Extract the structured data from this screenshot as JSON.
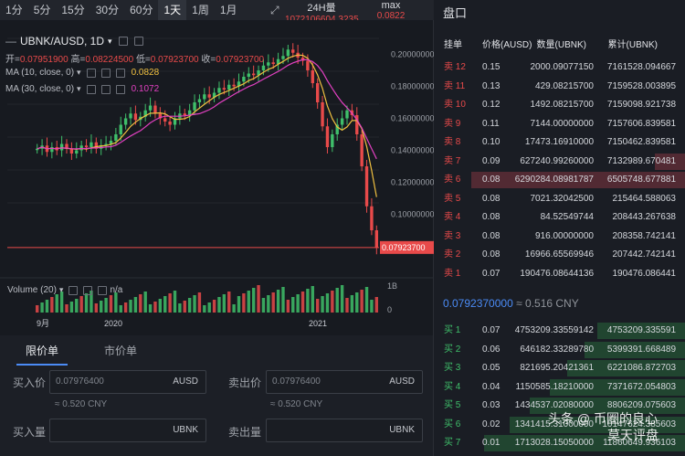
{
  "intervals": [
    "1分",
    "5分",
    "15分",
    "30分",
    "60分",
    "1天",
    "1周",
    "1月"
  ],
  "active_interval": "1天",
  "stats": {
    "volume_label": "24H量",
    "volume_value": "1072106604.3235",
    "max_label": "max",
    "max_value": "0.0822"
  },
  "chart": {
    "pair": "UBNK/AUSD, 1D",
    "ohlc": {
      "open_label": "开=",
      "open": "0.07951900",
      "high_label": "高=",
      "high": "0.08224500",
      "low_label": "低=",
      "low": "0.07923700",
      "close_label": "收=",
      "close": "0.07923700"
    },
    "ma10": {
      "label": "MA (10, close, 0)",
      "value": "0.0828"
    },
    "ma30": {
      "label": "MA (30, close, 0)",
      "value": "0.1072"
    },
    "volume_label": "Volume (20)",
    "volume_value": "n/a",
    "volume_axis": "1B",
    "volume_axis_zero": "0",
    "price_ticks": [
      "0.20000000",
      "0.18000000",
      "0.16000000",
      "0.14000000",
      "0.12000000",
      "0.10000000"
    ],
    "last_price": "0.07923700",
    "x_labels": [
      "9月",
      "2020",
      "2021"
    ],
    "colors": {
      "up": "#3fbf6a",
      "down": "#e84a4a",
      "ma10": "#f0c040",
      "ma30": "#e040c0"
    }
  },
  "chart_data": {
    "type": "candlestick",
    "title": "UBNK/AUSD, 1D",
    "ylim": [
      0.07,
      0.21
    ],
    "x_labels": [
      "9月",
      "2020",
      "2021"
    ],
    "close_series": [
      0.141,
      0.143,
      0.139,
      0.142,
      0.14,
      0.144,
      0.141,
      0.138,
      0.14,
      0.143,
      0.142,
      0.145,
      0.141,
      0.143,
      0.144,
      0.146,
      0.15,
      0.156,
      0.16,
      0.163,
      0.159,
      0.161,
      0.165,
      0.168,
      0.163,
      0.16,
      0.158,
      0.156,
      0.16,
      0.163,
      0.162,
      0.165,
      0.17,
      0.172,
      0.175,
      0.173,
      0.176,
      0.179,
      0.178,
      0.181,
      0.18,
      0.183,
      0.186,
      0.188,
      0.187,
      0.19,
      0.193,
      0.195,
      0.194,
      0.197,
      0.199,
      0.203,
      0.201,
      0.198,
      0.196,
      0.19,
      0.182,
      0.17,
      0.155,
      0.142,
      0.15,
      0.156,
      0.16,
      0.165,
      0.162,
      0.15,
      0.13,
      0.105,
      0.09,
      0.079
    ],
    "ma10": 0.0828,
    "ma30": 0.1072,
    "last": 0.079237
  },
  "form": {
    "tabs": [
      "限价单",
      "市价单"
    ],
    "active_tab": "限价单",
    "buy": {
      "price_label": "买入价",
      "price_value": "0.07976400",
      "price_unit": "AUSD",
      "cny": "≈ 0.520 CNY",
      "amount_label": "买入量",
      "amount_unit": "UBNK"
    },
    "sell": {
      "price_label": "卖出价",
      "price_value": "0.07976400",
      "price_unit": "AUSD",
      "cny": "≈ 0.520 CNY",
      "amount_label": "卖出量",
      "amount_unit": "UBNK"
    }
  },
  "book": {
    "title": "盘口",
    "headers": [
      "挂单",
      "价格(AUSD)",
      "数量(UBNK)",
      "累计(UBNK)"
    ],
    "asks": [
      {
        "label": "卖 12",
        "price": "0.15",
        "qty": "2000.09077150",
        "total": "7161528.094667",
        "depth": 0.0
      },
      {
        "label": "卖 11",
        "price": "0.13",
        "qty": "429.08215700",
        "total": "7159528.003895",
        "depth": 0.0
      },
      {
        "label": "卖 10",
        "price": "0.12",
        "qty": "1492.08215700",
        "total": "7159098.921738",
        "depth": 0.0
      },
      {
        "label": "卖 9",
        "price": "0.11",
        "qty": "7144.00000000",
        "total": "7157606.839581",
        "depth": 0.0
      },
      {
        "label": "卖 8",
        "price": "0.10",
        "qty": "17473.16910000",
        "total": "7150462.839581",
        "depth": 0.0
      },
      {
        "label": "卖 7",
        "price": "0.09",
        "qty": "627240.99260000",
        "total": "7132989.670481",
        "depth": 0.12
      },
      {
        "label": "卖 6",
        "price": "0.08",
        "qty": "6290284.08981787",
        "total": "6505748.677881",
        "depth": 0.85
      },
      {
        "label": "卖 5",
        "price": "0.08",
        "qty": "7021.32042500",
        "total": "215464.588063",
        "depth": 0.0
      },
      {
        "label": "卖 4",
        "price": "0.08",
        "qty": "84.52549744",
        "total": "208443.267638",
        "depth": 0.0
      },
      {
        "label": "卖 3",
        "price": "0.08",
        "qty": "916.00000000",
        "total": "208358.742141",
        "depth": 0.0
      },
      {
        "label": "卖 2",
        "price": "0.08",
        "qty": "16966.65569946",
        "total": "207442.742141",
        "depth": 0.0
      },
      {
        "label": "卖 1",
        "price": "0.07",
        "qty": "190476.08644136",
        "total": "190476.086441",
        "depth": 0.0
      }
    ],
    "mid_price": "0.0792370000",
    "mid_cny": "≈ 0.516 CNY",
    "bids": [
      {
        "label": "买 1",
        "price": "0.07",
        "qty": "4753209.33559142",
        "total": "4753209.335591",
        "depth": 0.35
      },
      {
        "label": "买 2",
        "price": "0.06",
        "qty": "646182.33289780",
        "total": "5399391.668489",
        "depth": 0.4
      },
      {
        "label": "买 3",
        "price": "0.05",
        "qty": "821695.20421361",
        "total": "6221086.872703",
        "depth": 0.47
      },
      {
        "label": "买 4",
        "price": "0.04",
        "qty": "1150585.18210000",
        "total": "7371672.054803",
        "depth": 0.54
      },
      {
        "label": "买 5",
        "price": "0.03",
        "qty": "1434537.02080000",
        "total": "8806209.075603",
        "depth": 0.62
      },
      {
        "label": "买 6",
        "price": "0.02",
        "qty": "1341415.31000000",
        "total": "10147624.385603",
        "depth": 0.7
      },
      {
        "label": "买 7",
        "price": "0.01",
        "qty": "1713028.15050000",
        "total": "11860649.936103",
        "depth": 0.8
      }
    ]
  },
  "watermark": [
    "头条 @ 币圈的良心",
    "莫天评盘"
  ]
}
